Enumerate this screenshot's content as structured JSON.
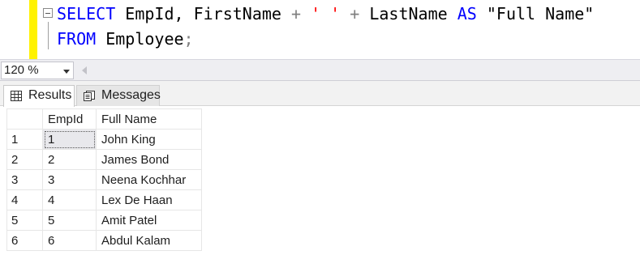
{
  "editor": {
    "line1": {
      "kw_select": "SELECT",
      "part_cols": " EmpId, FirstName ",
      "op_plus1": "+",
      "space1": " ",
      "str_space": "' '",
      "space2": " ",
      "op_plus2": "+",
      "part_last": " LastName ",
      "kw_as": "AS",
      "part_alias": " \"Full Name\""
    },
    "line2": {
      "kw_from": "FROM",
      "part_table": " Employee",
      "op_semicolon": ";"
    }
  },
  "zoom": {
    "value": "120 %"
  },
  "tabs": [
    {
      "label": "Results",
      "icon": "grid-icon"
    },
    {
      "label": "Messages",
      "icon": "messages-icon"
    }
  ],
  "grid": {
    "columns": [
      "",
      "EmpId",
      "Full Name"
    ],
    "rows": [
      {
        "num": "1",
        "id": "1",
        "name": "John King"
      },
      {
        "num": "2",
        "id": "2",
        "name": "James Bond"
      },
      {
        "num": "3",
        "id": "3",
        "name": "Neena Kochhar"
      },
      {
        "num": "4",
        "id": "4",
        "name": "Lex De Haan"
      },
      {
        "num": "5",
        "id": "5",
        "name": "Amit Patel"
      },
      {
        "num": "6",
        "id": "6",
        "name": "Abdul Kalam"
      }
    ]
  },
  "colors": {
    "keyword": "#0000ff",
    "string": "#ff0000",
    "operator": "#808080",
    "change_margin": "#fff200"
  }
}
